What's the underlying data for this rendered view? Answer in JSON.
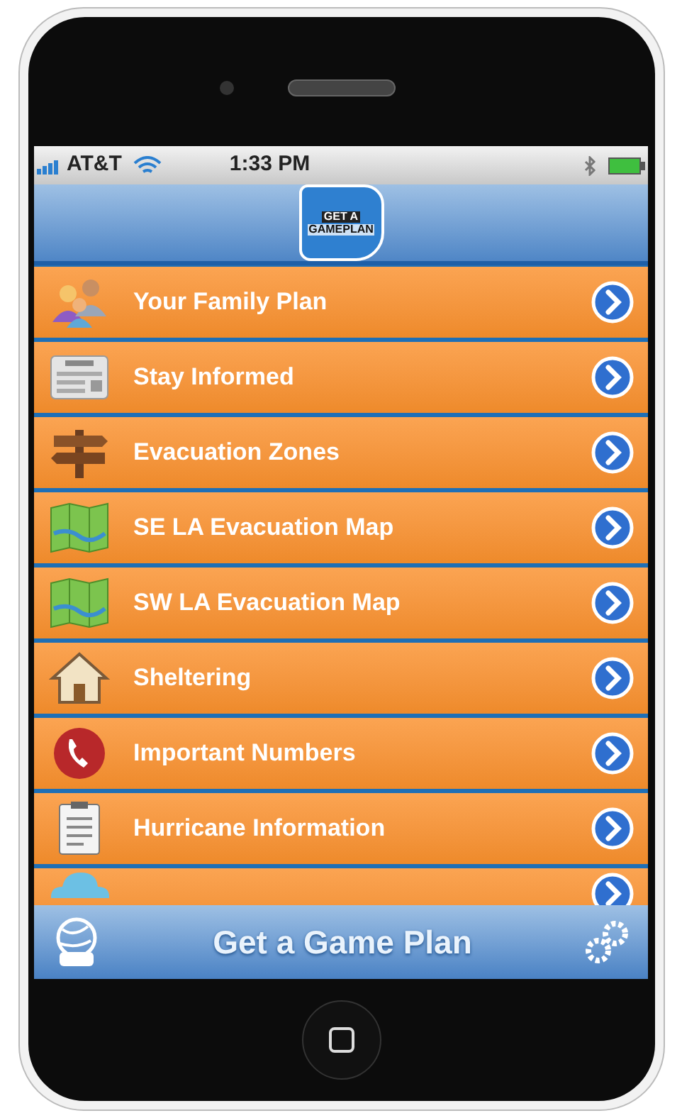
{
  "status_bar": {
    "carrier": "AT&T",
    "time": "1:33 PM"
  },
  "logo": {
    "line_1": "GET A",
    "line_2": "GAMEPLAN"
  },
  "menu": [
    {
      "kind": "family",
      "label": "Your Family Plan"
    },
    {
      "kind": "news",
      "label": "Stay Informed"
    },
    {
      "kind": "signpost",
      "label": "Evacuation Zones"
    },
    {
      "kind": "map",
      "label": "SE LA Evacuation Map"
    },
    {
      "kind": "map",
      "label": "SW LA Evacuation Map"
    },
    {
      "kind": "house",
      "label": "Sheltering"
    },
    {
      "kind": "phone",
      "label": "Important Numbers"
    },
    {
      "kind": "clipboard",
      "label": "Hurricane Information"
    },
    {
      "kind": "cloud"
    }
  ],
  "tab_bar": {
    "title": "Get a Game Plan"
  }
}
